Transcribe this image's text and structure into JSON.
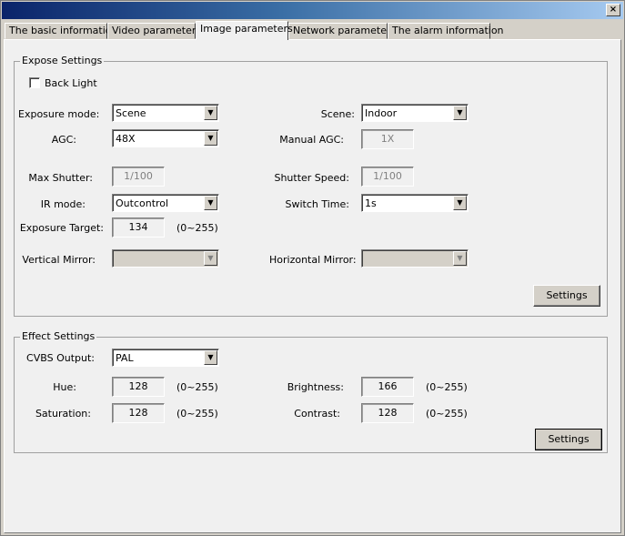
{
  "window": {
    "close_glyph": "×"
  },
  "tabs": [
    {
      "label": "The basic information"
    },
    {
      "label": "Video parameters"
    },
    {
      "label": "Image parameters"
    },
    {
      "label": "Network parameters"
    },
    {
      "label": "The alarm information"
    }
  ],
  "expose": {
    "title": "Expose Settings",
    "backlight_label": "Back Light",
    "exposure_mode": {
      "label": "Exposure mode:",
      "value": "Scene"
    },
    "scene": {
      "label": "Scene:",
      "value": "Indoor"
    },
    "agc": {
      "label": "AGC:",
      "value": "48X"
    },
    "manual_agc": {
      "label": "Manual AGC:",
      "value": "1X"
    },
    "max_shutter": {
      "label": "Max Shutter:",
      "value": "1/100"
    },
    "shutter_speed": {
      "label": "Shutter Speed:",
      "value": "1/100"
    },
    "ir_mode": {
      "label": "IR mode:",
      "value": "Outcontrol"
    },
    "switch_time": {
      "label": "Switch Time:",
      "value": "1s"
    },
    "exposure_target": {
      "label": "Exposure Target:",
      "value": "134",
      "range": "(0~255)"
    },
    "vertical_mirror": {
      "label": "Vertical Mirror:",
      "value": ""
    },
    "horizontal_mirror": {
      "label": "Horizontal Mirror:",
      "value": ""
    },
    "settings_label": "Settings"
  },
  "effect": {
    "title": "Effect Settings",
    "cvbs": {
      "label": "CVBS Output:",
      "value": "PAL"
    },
    "hue": {
      "label": "Hue:",
      "value": "128",
      "range": "(0~255)"
    },
    "brightness": {
      "label": "Brightness:",
      "value": "166",
      "range": "(0~255)"
    },
    "saturation": {
      "label": "Saturation:",
      "value": "128",
      "range": "(0~255)"
    },
    "contrast": {
      "label": "Contrast:",
      "value": "128",
      "range": "(0~255)"
    },
    "settings_label": "Settings"
  },
  "icons": {
    "dropdown": "chevron-down-icon",
    "close": "close-icon"
  }
}
